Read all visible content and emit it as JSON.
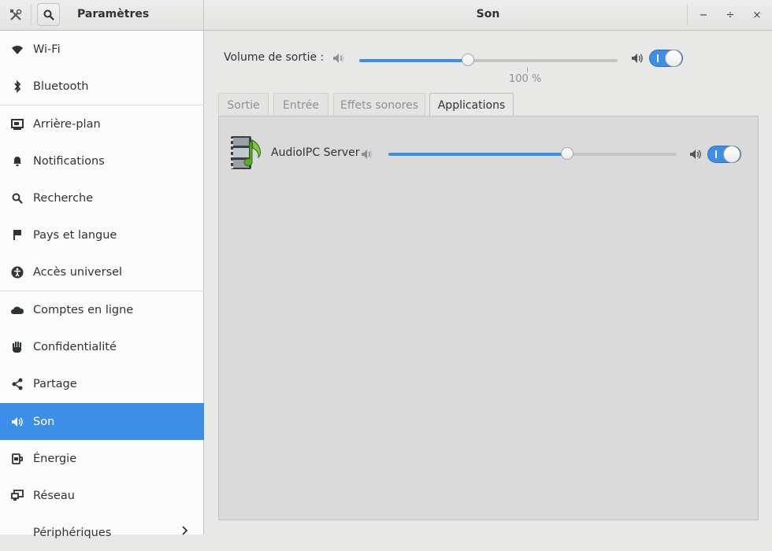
{
  "header": {
    "left_title": "Paramètres",
    "main_title": "Son",
    "icons": {
      "tools": "tools-icon",
      "search": "search-icon"
    },
    "window_controls": {
      "minimize": "−",
      "maximize": "÷",
      "close": "×"
    }
  },
  "sidebar": {
    "items": [
      {
        "label": "Wi-Fi",
        "icon": "wifi-icon"
      },
      {
        "label": "Bluetooth",
        "icon": "bluetooth-icon"
      },
      {
        "label": "Arrière-plan",
        "icon": "background-icon"
      },
      {
        "label": "Notifications",
        "icon": "bell-icon"
      },
      {
        "label": "Recherche",
        "icon": "search-icon"
      },
      {
        "label": "Pays et langue",
        "icon": "flag-icon"
      },
      {
        "label": "Accès universel",
        "icon": "accessibility-icon"
      },
      {
        "label": "Comptes en ligne",
        "icon": "cloud-icon"
      },
      {
        "label": "Confidentialité",
        "icon": "hand-icon"
      },
      {
        "label": "Partage",
        "icon": "share-icon"
      },
      {
        "label": "Son",
        "icon": "speaker-icon",
        "selected": true
      },
      {
        "label": "Énergie",
        "icon": "power-icon"
      },
      {
        "label": "Réseau",
        "icon": "network-icon"
      },
      {
        "label": "Périphériques",
        "icon": "chevron-right-icon"
      }
    ]
  },
  "output": {
    "label": "Volume de sortie :",
    "volume_fraction": 0.42,
    "marker_label": "100 %",
    "switch_on": true
  },
  "tabs": [
    {
      "label": "Sortie",
      "active": false
    },
    {
      "label": "Entrée",
      "active": false
    },
    {
      "label": "Effets sonores",
      "active": false
    },
    {
      "label": "Applications",
      "active": true
    }
  ],
  "applications": [
    {
      "name": "AudioIPC Server",
      "volume_fraction": 0.62,
      "switch_on": true,
      "icon": "multimedia-audio-icon"
    }
  ],
  "colors": {
    "accent": "#3d8ee6",
    "sidebar_bg": "#fbfbfb",
    "panel_bg": "#dadada"
  }
}
